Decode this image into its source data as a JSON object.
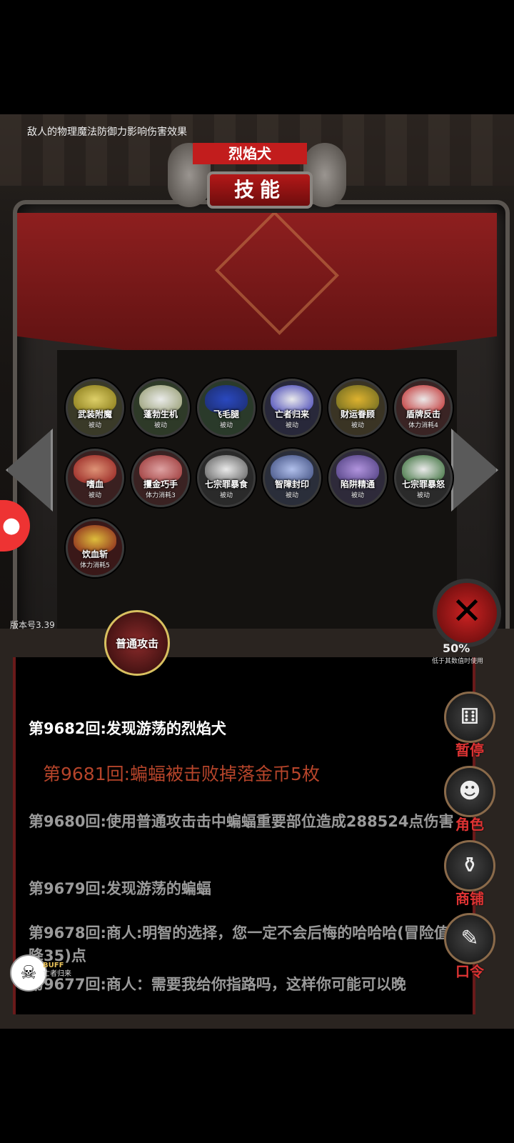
{
  "hint": "敌人的物理魔法防御力影响伤害效果",
  "monster_name": "烈焰犬",
  "panel_title": "技能",
  "skills": [
    {
      "name": "武装附魔",
      "tag": "被动",
      "art": "background:radial-gradient(#f0e070,#8a7a10);"
    },
    {
      "name": "蓬勃生机",
      "tag": "被动",
      "art": "background:radial-gradient(#ffffff,#9aa070);"
    },
    {
      "name": "飞毛腿",
      "tag": "被动",
      "art": "background:radial-gradient(#2a4ad0,#1a2a70);"
    },
    {
      "name": "亡者归来",
      "tag": "被动",
      "art": "background:radial-gradient(#ffffff,#3a3ac0);"
    },
    {
      "name": "财运眷顾",
      "tag": "被动",
      "art": "background:radial-gradient(#f0c030,#6a6a20);"
    },
    {
      "name": "盾牌反击",
      "tag": "体力消耗4",
      "art": "background:radial-gradient(#ffffff,#c22);"
    },
    {
      "name": "嗜血",
      "tag": "被动",
      "art": "background:radial-gradient(#f0a080,#9a1a1a);"
    },
    {
      "name": "攫金巧手",
      "tag": "体力消耗3",
      "art": "background:radial-gradient(#f0b0b0,#a03030);"
    },
    {
      "name": "七宗罪暴食",
      "tag": "被动",
      "art": "background:radial-gradient(#ffffff,#5a5a5a);"
    },
    {
      "name": "智障封印",
      "tag": "被动",
      "art": "background:radial-gradient(#c0d0ff,#3a4a80);"
    },
    {
      "name": "陷阱精通",
      "tag": "被动",
      "art": "background:radial-gradient(#c0a0f0,#4a3a80);"
    },
    {
      "name": "七宗罪暴怒",
      "tag": "被动",
      "art": "background:radial-gradient(#ffffff,#2a6a2a);"
    },
    {
      "name": "饮血斩",
      "tag": "体力消耗5",
      "art": "background:radial-gradient(#f0d040,#8a1a1a);"
    }
  ],
  "version": "版本号3.39",
  "attack_label": "普通攻击",
  "hp": "50%",
  "hp_note": "低于其数值时使用",
  "log": [
    "第9682回:发现游荡的烈焰犬",
    "第9681回:蝙蝠被击败掉落金币5枚",
    "第9680回:使用普通攻击击中蝙蝠重要部位造成288524点伤害",
    "第9679回:发现游荡的蝙蝠",
    "第9678回:商人:明智的选择，您一定不会后悔的哈哈哈(冒险值下降35)点",
    "第9677回:商人：需要我给你指路吗，这样你可能可以晚"
  ],
  "log_styles": [
    "color:#ffffff;"
  ],
  "side_buttons": [
    "暂停",
    "角色",
    "商铺",
    "口令"
  ],
  "buff": {
    "label": "BUFF",
    "name": "亡者归来"
  }
}
